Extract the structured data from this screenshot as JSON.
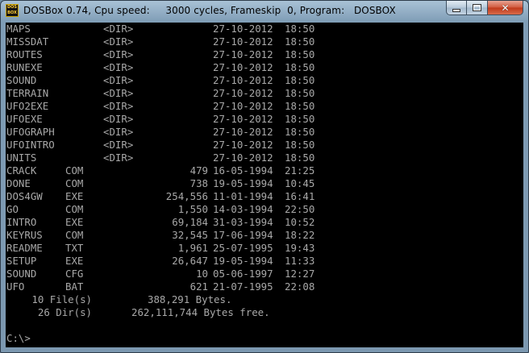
{
  "window": {
    "title": "DOSBox 0.74, Cpu speed:     3000 cycles, Frameskip  0, Program:   DOSBOX",
    "icon_text_top": "DOS",
    "icon_text_bottom": "BOX",
    "close_glyph": "✕"
  },
  "directory": {
    "dirs": [
      {
        "name": "MAPS",
        "ext": "",
        "tag": "<DIR>",
        "date": "27-10-2012",
        "time": "18:50"
      },
      {
        "name": "MISSDAT",
        "ext": "",
        "tag": "<DIR>",
        "date": "27-10-2012",
        "time": "18:50"
      },
      {
        "name": "ROUTES",
        "ext": "",
        "tag": "<DIR>",
        "date": "27-10-2012",
        "time": "18:50"
      },
      {
        "name": "RUNEXE",
        "ext": "",
        "tag": "<DIR>",
        "date": "27-10-2012",
        "time": "18:50"
      },
      {
        "name": "SOUND",
        "ext": "",
        "tag": "<DIR>",
        "date": "27-10-2012",
        "time": "18:50"
      },
      {
        "name": "TERRAIN",
        "ext": "",
        "tag": "<DIR>",
        "date": "27-10-2012",
        "time": "18:50"
      },
      {
        "name": "UFO2EXE",
        "ext": "",
        "tag": "<DIR>",
        "date": "27-10-2012",
        "time": "18:50"
      },
      {
        "name": "UFOEXE",
        "ext": "",
        "tag": "<DIR>",
        "date": "27-10-2012",
        "time": "18:50"
      },
      {
        "name": "UFOGRAPH",
        "ext": "",
        "tag": "<DIR>",
        "date": "27-10-2012",
        "time": "18:50"
      },
      {
        "name": "UFOINTRO",
        "ext": "",
        "tag": "<DIR>",
        "date": "27-10-2012",
        "time": "18:50"
      },
      {
        "name": "UNITS",
        "ext": "",
        "tag": "<DIR>",
        "date": "27-10-2012",
        "time": "18:50"
      }
    ],
    "files": [
      {
        "name": "CRACK",
        "ext": "COM",
        "size": "479",
        "date": "16-05-1994",
        "time": "21:25"
      },
      {
        "name": "DONE",
        "ext": "COM",
        "size": "738",
        "date": "19-05-1994",
        "time": "10:45"
      },
      {
        "name": "DOS4GW",
        "ext": "EXE",
        "size": "254,556",
        "date": "11-01-1994",
        "time": "16:41"
      },
      {
        "name": "GO",
        "ext": "COM",
        "size": "1,550",
        "date": "14-03-1994",
        "time": "22:50"
      },
      {
        "name": "INTRO",
        "ext": "EXE",
        "size": "69,184",
        "date": "31-03-1994",
        "time": "10:52"
      },
      {
        "name": "KEYRUS",
        "ext": "COM",
        "size": "32,545",
        "date": "17-06-1994",
        "time": "18:22"
      },
      {
        "name": "README",
        "ext": "TXT",
        "size": "1,961",
        "date": "25-07-1995",
        "time": "19:43"
      },
      {
        "name": "SETUP",
        "ext": "EXE",
        "size": "26,647",
        "date": "19-05-1994",
        "time": "11:33"
      },
      {
        "name": "SOUND",
        "ext": "CFG",
        "size": "10",
        "date": "05-06-1997",
        "time": "12:27"
      },
      {
        "name": "UFO",
        "ext": "BAT",
        "size": "621",
        "date": "21-07-1995",
        "time": "22:08"
      }
    ],
    "summary": {
      "files_count": "10 File(s)",
      "files_bytes": "388,291 Bytes.",
      "dirs_count": "26 Dir(s)",
      "dirs_bytes": "262,111,744 Bytes free."
    }
  },
  "prompt": "C:\\>"
}
